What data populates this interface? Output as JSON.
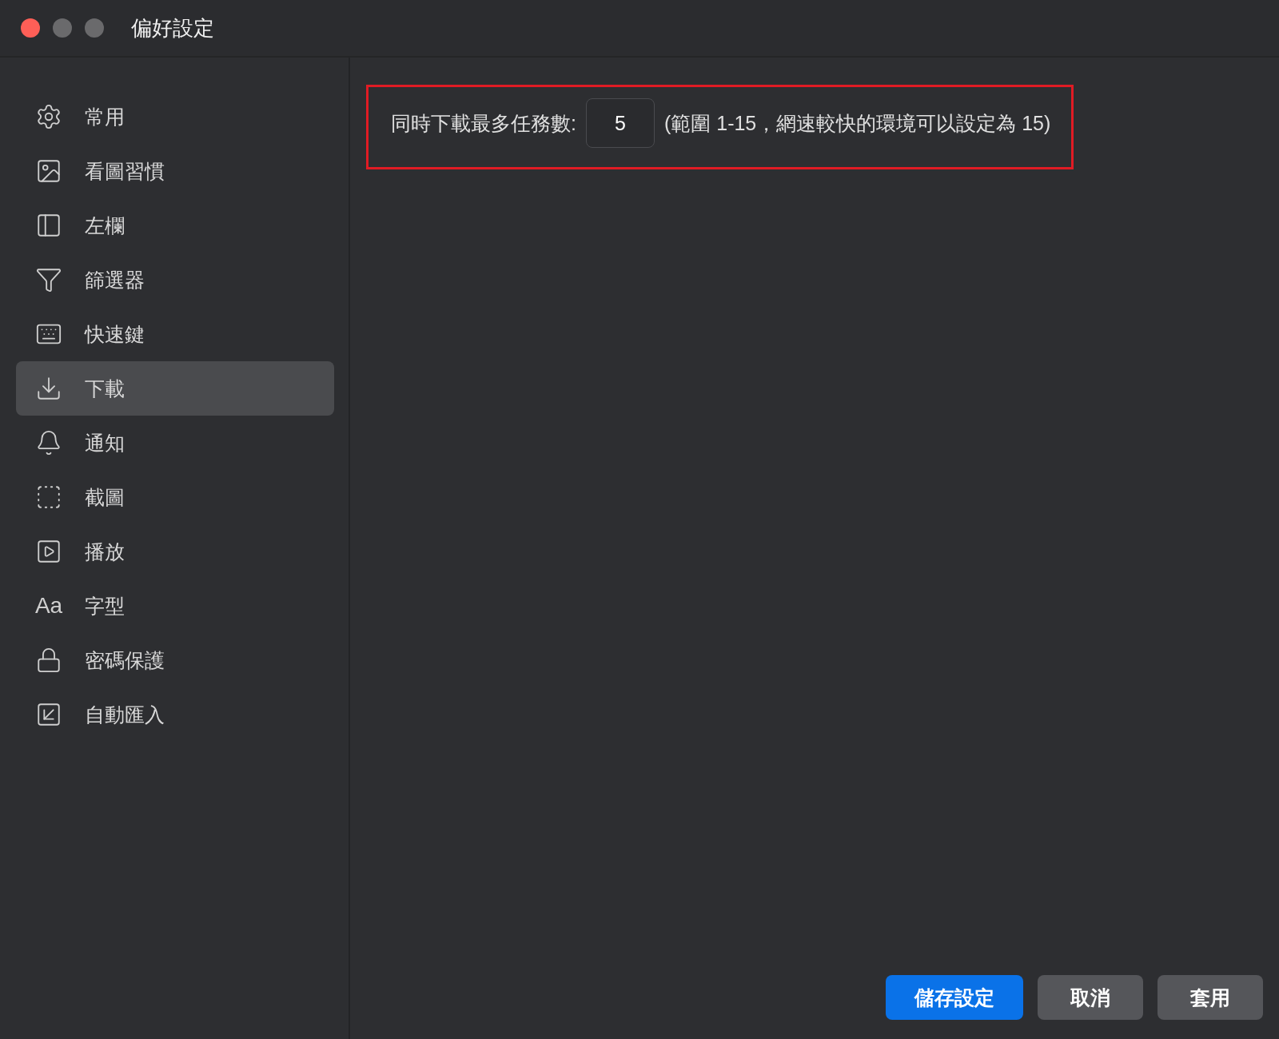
{
  "window": {
    "title": "偏好設定"
  },
  "sidebar": {
    "items": [
      {
        "label": "常用",
        "selected": false
      },
      {
        "label": "看圖習慣",
        "selected": false
      },
      {
        "label": "左欄",
        "selected": false
      },
      {
        "label": "篩選器",
        "selected": false
      },
      {
        "label": "快速鍵",
        "selected": false
      },
      {
        "label": "下載",
        "selected": true
      },
      {
        "label": "通知",
        "selected": false
      },
      {
        "label": "截圖",
        "selected": false
      },
      {
        "label": "播放",
        "selected": false
      },
      {
        "label": "字型",
        "selected": false,
        "glyph": "Aa"
      },
      {
        "label": "密碼保護",
        "selected": false
      },
      {
        "label": "自動匯入",
        "selected": false
      }
    ]
  },
  "download_setting": {
    "label": "同時下載最多任務數:",
    "value": "5",
    "hint": "(範圍 1-15，網速較快的環境可以設定為 15)"
  },
  "buttons": [
    {
      "label": "儲存設定",
      "kind": "primary"
    },
    {
      "label": "取消",
      "kind": "secondary"
    },
    {
      "label": "套用",
      "kind": "secondary"
    }
  ]
}
